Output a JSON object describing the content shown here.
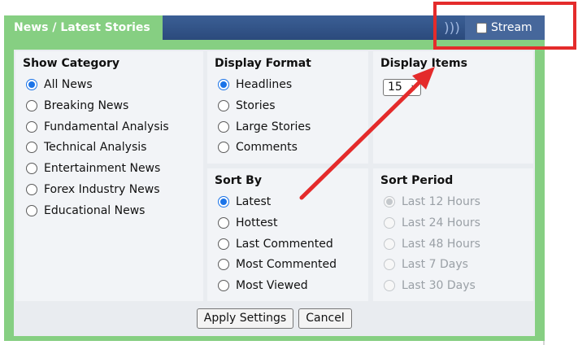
{
  "header": {
    "tab_title": "News / Latest Stories",
    "stream_icon": "radio-waves-icon",
    "stream_label": "Stream",
    "stream_checked": false
  },
  "show_category": {
    "title": "Show Category",
    "options": [
      {
        "label": "All News",
        "checked": true
      },
      {
        "label": "Breaking News",
        "checked": false
      },
      {
        "label": "Fundamental Analysis",
        "checked": false
      },
      {
        "label": "Technical Analysis",
        "checked": false
      },
      {
        "label": "Entertainment News",
        "checked": false
      },
      {
        "label": "Forex Industry News",
        "checked": false
      },
      {
        "label": "Educational News",
        "checked": false
      }
    ]
  },
  "display_format": {
    "title": "Display Format",
    "options": [
      {
        "label": "Headlines",
        "checked": true
      },
      {
        "label": "Stories",
        "checked": false
      },
      {
        "label": "Large Stories",
        "checked": false
      },
      {
        "label": "Comments",
        "checked": false
      }
    ]
  },
  "display_items": {
    "title": "Display Items",
    "selected": "15"
  },
  "sort_by": {
    "title": "Sort By",
    "options": [
      {
        "label": "Latest",
        "checked": true
      },
      {
        "label": "Hottest",
        "checked": false
      },
      {
        "label": "Last Commented",
        "checked": false
      },
      {
        "label": "Most Commented",
        "checked": false
      },
      {
        "label": "Most Viewed",
        "checked": false
      }
    ]
  },
  "sort_period": {
    "title": "Sort Period",
    "disabled": true,
    "options": [
      {
        "label": "Last 12 Hours",
        "checked": true
      },
      {
        "label": "Last 24 Hours",
        "checked": false
      },
      {
        "label": "Last 48 Hours",
        "checked": false
      },
      {
        "label": "Last 7 Days",
        "checked": false
      },
      {
        "label": "Last 30 Days",
        "checked": false
      }
    ]
  },
  "buttons": {
    "apply": "Apply Settings",
    "cancel": "Cancel"
  },
  "annotation_color": "#e42b2b"
}
